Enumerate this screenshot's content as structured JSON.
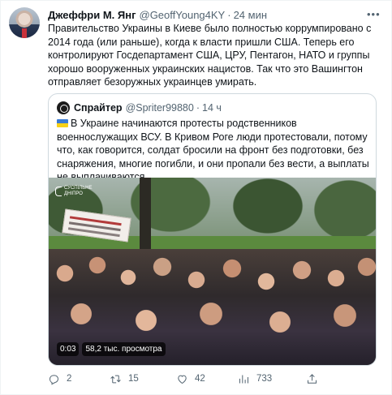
{
  "tweet": {
    "author_name": "Джеффри М. Янг",
    "author_handle": "@GeoffYoung4KY",
    "separator": "·",
    "time": "24 мин",
    "text": "Правительство Украины в Киеве было полностью коррумпировано с 2014 года (или раньше), когда к власти пришли США. Теперь его контролируют Госдепартамент США, ЦРУ, Пентагон, НАТО и группы хорошо вооруженных украинских нацистов. Так что это Вашингтон отправляет безоружных украинцев умирать."
  },
  "quote": {
    "author_name": "Спрайтер",
    "author_handle": "@Spriter99880",
    "separator": "·",
    "time": "14 ч",
    "text": "В Украине начинаются протесты родственников военнослужащих ВСУ. В Кривом Роге люди протестовали, потому что, как говорится, солдат бросили на фронт без подготовки, без снаряжения, многие погибли, и они пропали без вести, а выплаты не выплачиваются.",
    "video": {
      "channel_logo_line1": "СУСПІЛЬНЕ",
      "channel_logo_line2": "ДНІПРО",
      "duration": "0:03",
      "views": "58,2 тыс. просмотра"
    }
  },
  "actions": {
    "replies": "2",
    "retweets": "15",
    "likes": "42",
    "views": "733"
  },
  "icons": {
    "more": "more-icon",
    "reply": "reply-icon",
    "retweet": "retweet-icon",
    "like": "heart-icon",
    "views": "views-icon",
    "share": "share-icon",
    "flag": "ukraine-flag-icon"
  },
  "colors": {
    "text": "#0f1419",
    "secondary": "#536471",
    "border": "#cfd9de"
  }
}
